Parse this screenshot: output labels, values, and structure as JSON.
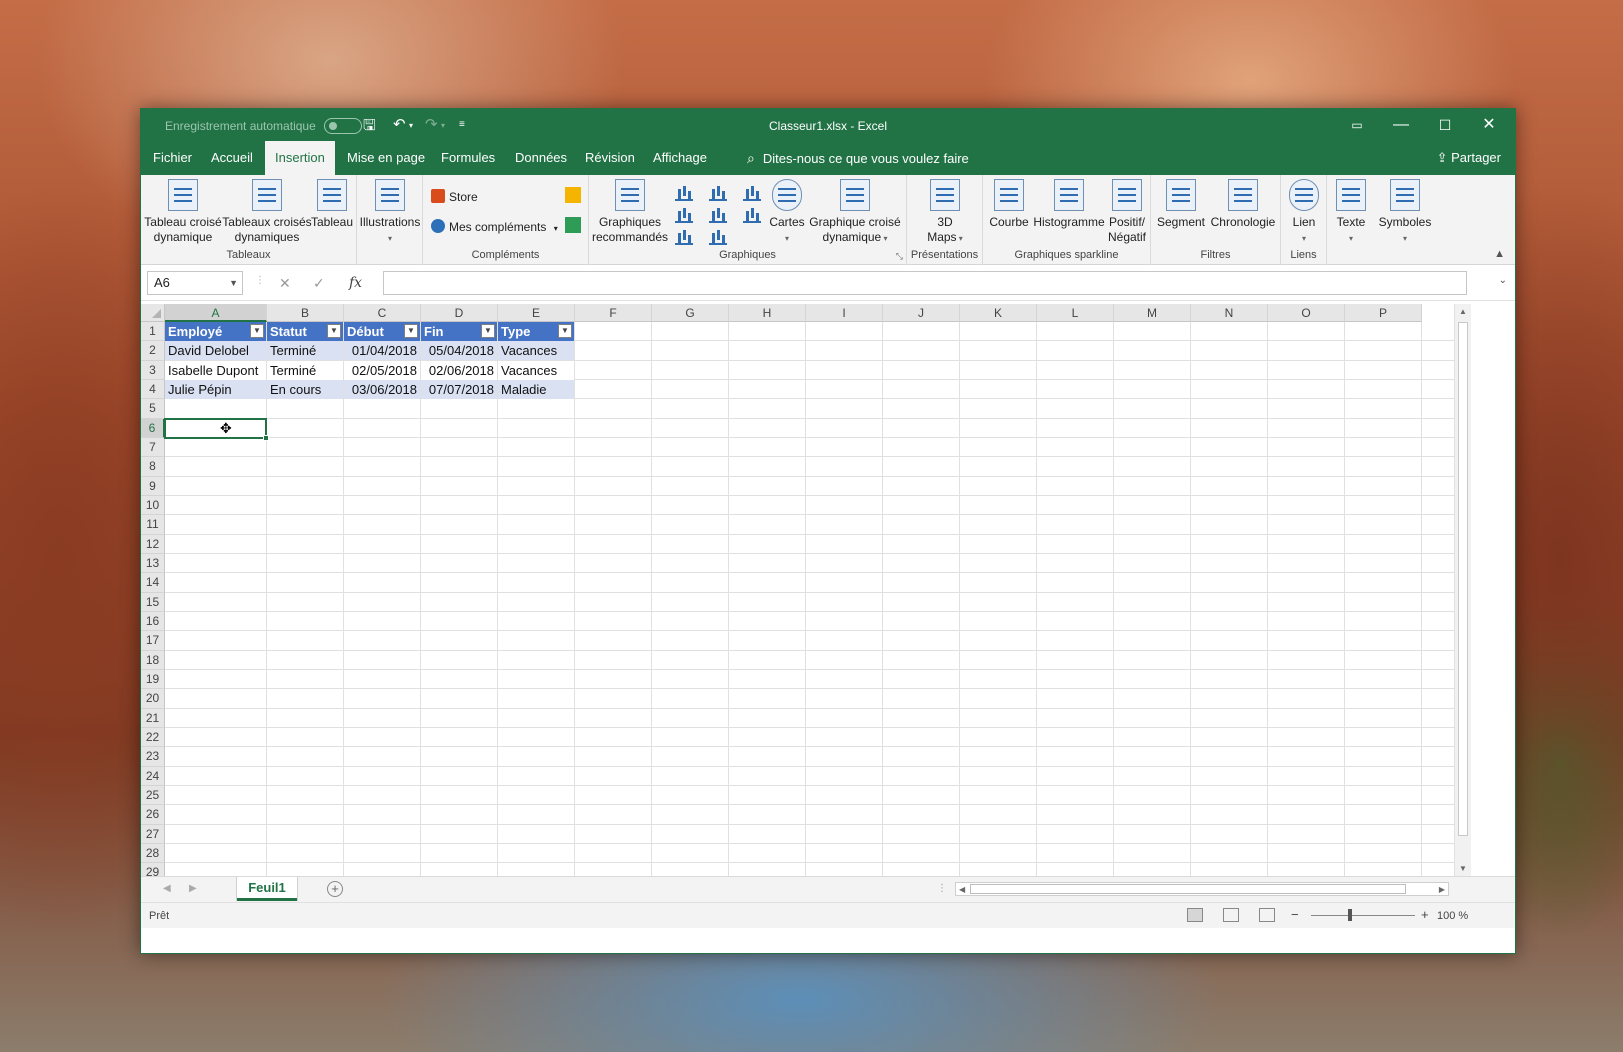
{
  "window": {
    "autosave_label": "Enregistrement automatique",
    "title": "Classeur1.xlsx  -  Excel"
  },
  "tabs": [
    "Fichier",
    "Accueil",
    "Insertion",
    "Mise en page",
    "Formules",
    "Données",
    "Révision",
    "Affichage"
  ],
  "active_tab": "Insertion",
  "tell_me": "Dites-nous ce que vous voulez faire",
  "share": "Partager",
  "ribbon": {
    "tableaux": {
      "label": "Tableaux",
      "btn1": [
        "Tableau croisé",
        "dynamique"
      ],
      "btn2": [
        "Tableaux croisés",
        "dynamiques"
      ],
      "btn3": "Tableau"
    },
    "illustrations": {
      "label": "Illustrations"
    },
    "complements": {
      "label": "Compléments",
      "store": "Store",
      "mes": "Mes compléments"
    },
    "graphiques": {
      "label": "Graphiques",
      "recommandes": [
        "Graphiques",
        "recommandés"
      ],
      "cartes": "Cartes",
      "croise": [
        "Graphique croisé",
        "dynamique"
      ]
    },
    "presentations": {
      "label": "Présentations",
      "btn": [
        "3D",
        "Maps"
      ]
    },
    "sparkline": {
      "label": "Graphiques sparkline",
      "courbe": "Courbe",
      "histogramme": "Histogramme",
      "positif": [
        "Positif/",
        "Négatif"
      ]
    },
    "filtres": {
      "label": "Filtres",
      "segment": "Segment",
      "chronologie": "Chronologie"
    },
    "liens": {
      "label": "Liens",
      "lien": "Lien"
    },
    "texte": "Texte",
    "symboles": "Symboles"
  },
  "formula_bar": {
    "name_box": "A6",
    "fx": "fx",
    "value": ""
  },
  "columns": [
    "A",
    "B",
    "C",
    "D",
    "E",
    "F",
    "G",
    "H",
    "I",
    "J",
    "K",
    "L",
    "M",
    "N",
    "O",
    "P"
  ],
  "rows": [
    "1",
    "2",
    "3",
    "4",
    "5",
    "6",
    "7",
    "8",
    "9",
    "10",
    "11",
    "12",
    "13",
    "14",
    "15",
    "16",
    "17",
    "18",
    "19",
    "20",
    "21",
    "22",
    "23",
    "24",
    "25",
    "26",
    "27",
    "28",
    "29"
  ],
  "table": {
    "headers": [
      "Employé",
      "Statut",
      "Début",
      "Fin",
      "Type"
    ],
    "rows": [
      [
        "David Delobel",
        "Terminé",
        "01/04/2018",
        "05/04/2018",
        "Vacances"
      ],
      [
        "Isabelle Dupont",
        "Terminé",
        "02/05/2018",
        "02/06/2018",
        "Vacances"
      ],
      [
        "Julie Pépin",
        "En cours",
        "03/06/2018",
        "07/07/2018",
        "Maladie"
      ]
    ]
  },
  "sheet_tab": "Feuil1",
  "status": "Prêt",
  "zoom": "100 %",
  "colors": {
    "excel_green": "#217346",
    "table_header": "#4472c4",
    "table_band": "#d9e1f2"
  }
}
